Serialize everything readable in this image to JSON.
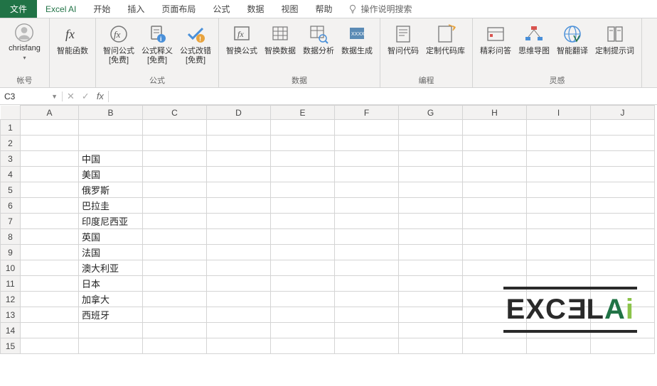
{
  "menu": {
    "file": "文件",
    "tabs": [
      "Excel AI",
      "开始",
      "插入",
      "页面布局",
      "公式",
      "数据",
      "视图",
      "帮助"
    ],
    "active_tab_index": 0,
    "search_placeholder": "操作说明搜索"
  },
  "ribbon": {
    "account": {
      "name": "chrisfang",
      "caption": "帐号"
    },
    "groups": [
      {
        "label": "",
        "items": [
          {
            "icon": "fx-circle",
            "label": "智能函数"
          }
        ]
      },
      {
        "label": "公式",
        "items": [
          {
            "icon": "fx-circle",
            "label": "智问公式\n[免费]"
          },
          {
            "icon": "doc-info",
            "label": "公式释义\n[免费]"
          },
          {
            "icon": "check-warn",
            "label": "公式改错\n[免费]"
          }
        ]
      },
      {
        "label": "数据",
        "items": [
          {
            "icon": "fx-box",
            "label": "智换公式"
          },
          {
            "icon": "grid-swap",
            "label": "智换数据"
          },
          {
            "icon": "grid-mag",
            "label": "数据分析"
          },
          {
            "icon": "grid-gen",
            "label": "数据生成"
          }
        ]
      },
      {
        "label": "编程",
        "items": [
          {
            "icon": "code-doc",
            "label": "智问代码"
          },
          {
            "icon": "code-lib",
            "label": "定制代码库"
          }
        ]
      },
      {
        "label": "灵感",
        "items": [
          {
            "icon": "qa",
            "label": "精彩问答"
          },
          {
            "icon": "mindmap",
            "label": "思维导图"
          },
          {
            "icon": "translate",
            "label": "智能翻译"
          },
          {
            "icon": "prompt",
            "label": "定制提示词"
          }
        ]
      }
    ]
  },
  "formula_bar": {
    "cell_ref": "C3",
    "value": ""
  },
  "grid": {
    "columns": [
      "A",
      "B",
      "C",
      "D",
      "E",
      "F",
      "G",
      "H",
      "I",
      "J"
    ],
    "rows": 15,
    "data": {
      "B": {
        "3": "中国",
        "4": "美国",
        "5": "俄罗斯",
        "6": "巴拉圭",
        "7": "印度尼西亚",
        "8": "英国",
        "9": "法国",
        "10": "澳大利亚",
        "11": "日本",
        "12": "加拿大",
        "13": "西班牙"
      }
    }
  },
  "watermark": {
    "text_main": "EXC",
    "text_e": "E",
    "text_l": "L",
    "text_a": "A",
    "text_i": "i"
  }
}
